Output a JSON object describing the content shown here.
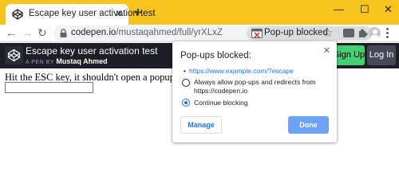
{
  "browser": {
    "tab": {
      "title": "Escape key user activation test",
      "favicon": "codepen-icon"
    },
    "new_tab_label": "+",
    "window_controls": {
      "minimize": "—",
      "maximize": "☐",
      "close": "✕"
    },
    "nav": {
      "back": "←",
      "forward": "→",
      "reload": "↻"
    },
    "omnibox": {
      "host": "codepen.io",
      "path": "/mustaqahmed/full/yrXLxZ",
      "popup_chip_label": "Pop-up blocked"
    },
    "bookmark_star": "☆"
  },
  "codepen_header": {
    "title": "Escape key user activation test",
    "byline_prefix": "A PEN BY",
    "author": "Mustaq Ahmed",
    "signup_label": "Sign Up",
    "login_label": "Log In",
    "colors": {
      "background": "#1e1f26",
      "signup": "#47cf73",
      "login": "#444857"
    }
  },
  "page": {
    "instruction": "Hit the ESC key, it shouldn't open a popup.",
    "input_value": ""
  },
  "popup_bubble": {
    "title": "Pop-ups blocked:",
    "close_label": "✕",
    "blocked_url": "https://www.example.com/?escape",
    "options": [
      {
        "label": "Always allow pop-ups and redirects from https://codepen.io",
        "selected": false
      },
      {
        "label": "Continue blocking",
        "selected": true
      }
    ],
    "manage_label": "Manage",
    "done_label": "Done",
    "accent_color": "#1a73e8"
  }
}
